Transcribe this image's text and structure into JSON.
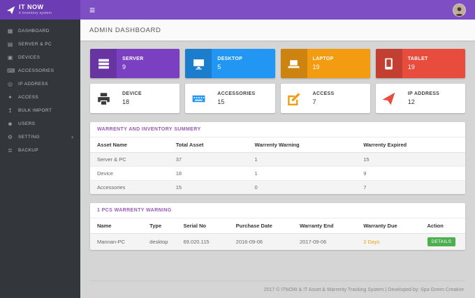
{
  "theme": {
    "primary": "#7d4ec4",
    "primary_dark": "#6b3cb3",
    "sidebar_bg": "#33363b",
    "panel_title": "#9b59b6",
    "warning": "#f39c12",
    "success": "#4caf50"
  },
  "topbar": {
    "logo_title": "IT NOW",
    "logo_subtitle": "it inventory system"
  },
  "sidebar": {
    "items": [
      {
        "label": "DASHBOARD",
        "icon": "dashboard"
      },
      {
        "label": "SERVER & PC",
        "icon": "desktop"
      },
      {
        "label": "DEVICES",
        "icon": "printer"
      },
      {
        "label": "ACCESSORIES",
        "icon": "keyboard"
      },
      {
        "label": "IP ADDRESS",
        "icon": "globe"
      },
      {
        "label": "ACCESS",
        "icon": "key"
      },
      {
        "label": "BULK IMPORT",
        "icon": "upload"
      },
      {
        "label": "USERS",
        "icon": "user"
      },
      {
        "label": "SETTING",
        "icon": "gear",
        "has_chevron": true
      },
      {
        "label": "BACKUP",
        "icon": "database"
      }
    ]
  },
  "page": {
    "title": "ADMIN DASHBOARD"
  },
  "stat_cards": [
    {
      "title": "SERVER",
      "value": "9",
      "style": "solid",
      "color": "#7b3fc1",
      "icon": "server"
    },
    {
      "title": "DESKTOP",
      "value": "5",
      "style": "solid",
      "color": "#2196f3",
      "icon": "desktop"
    },
    {
      "title": "LAPTOP",
      "value": "19",
      "style": "solid",
      "color": "#f39c12",
      "icon": "laptop"
    },
    {
      "title": "TABLET",
      "value": "19",
      "style": "solid",
      "color": "#e74c3c",
      "icon": "tablet"
    },
    {
      "title": "DEVICE",
      "value": "18",
      "style": "light",
      "accent": "#3a3a3a",
      "icon": "printer"
    },
    {
      "title": "ACCESSORIES",
      "value": "15",
      "style": "light",
      "accent": "#2196f3",
      "icon": "keyboard"
    },
    {
      "title": "ACCESS",
      "value": "7",
      "style": "light",
      "accent": "#f39c12",
      "icon": "edit"
    },
    {
      "title": "IP ADDRESS",
      "value": "12",
      "style": "light",
      "accent": "#e74c3c",
      "icon": "paper-plane"
    }
  ],
  "summary_panel": {
    "title": "WARRENTY AND INVENTORY SUMMERY",
    "columns": [
      "Asset Name",
      "Total Asset",
      "Warrenty Warning",
      "Warrenty Expired"
    ],
    "rows": [
      [
        "Server & PC",
        "37",
        "1",
        "15"
      ],
      [
        "Device",
        "18",
        "1",
        "9"
      ],
      [
        "Accessories",
        "15",
        "0",
        "7"
      ]
    ]
  },
  "warning_panel": {
    "title": "1 PCS WARRENTY WARNING",
    "columns": [
      "Name",
      "Type",
      "Serial No",
      "Purchase Date",
      "Warranty End",
      "Warranty Due",
      "Action"
    ],
    "row": {
      "name": "Mannan-PC",
      "type": "desktop",
      "serial": "69.020.115",
      "purchase_date": "2016-09-06",
      "warranty_end": "2017-09-06",
      "warranty_due": "2 Days",
      "action_label": "DETAILS"
    },
    "due_color": "#f39c12"
  },
  "footer": {
    "text": "2017 © ITNOW & IT Asset & Warrenty Tracking System | Developed by: Spa Green Creative"
  }
}
